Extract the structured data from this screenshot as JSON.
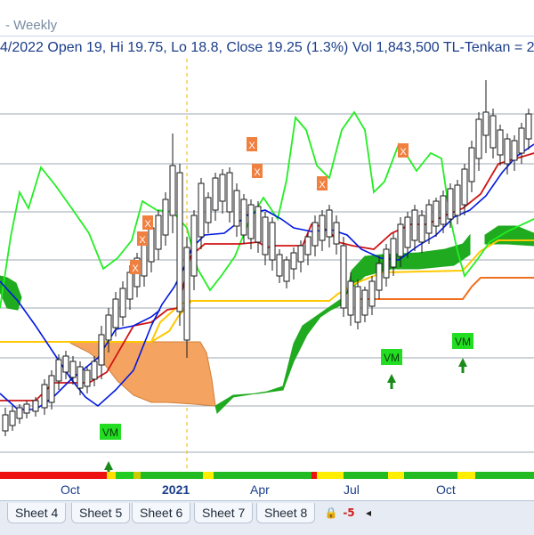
{
  "window": {
    "title": "- Weekly"
  },
  "info_bar": {
    "text": "4/2022 Open 19, Hi 19.75, Lo 18.8, Close 19.25 (1.3%) Vol 1,843,500 TL-Tenkan  = 2"
  },
  "chart": {
    "markers": [
      {
        "label": "X",
        "kind": "x-marker"
      },
      {
        "label": "VM",
        "kind": "vm-signal"
      }
    ],
    "vm_labels": [
      "VM",
      "VM",
      "VM"
    ],
    "x_labels": [
      "Oct",
      "2021",
      "Apr",
      "Jul",
      "Oct"
    ],
    "colors": {
      "candles": "#1a1a1a",
      "tenkan": "#0018e0",
      "kijun": "#d01515",
      "chikou": "#22ee22",
      "senkou_upper": "#ffc800",
      "senkou_lower": "#f07020",
      "cloud_bull": "#1faa1f",
      "cloud_bear": "#f4a460",
      "x_marker": "#f08040",
      "vm_box": "#22dd22",
      "arrow": "#1a8a1a"
    }
  },
  "sheet_tabs": [
    "Sheet 4",
    "Sheet 5",
    "Sheet 6",
    "Sheet 7",
    "Sheet 8"
  ],
  "tab_controls": {
    "lock": "🔒",
    "minus": "-5",
    "first": "◂"
  }
}
